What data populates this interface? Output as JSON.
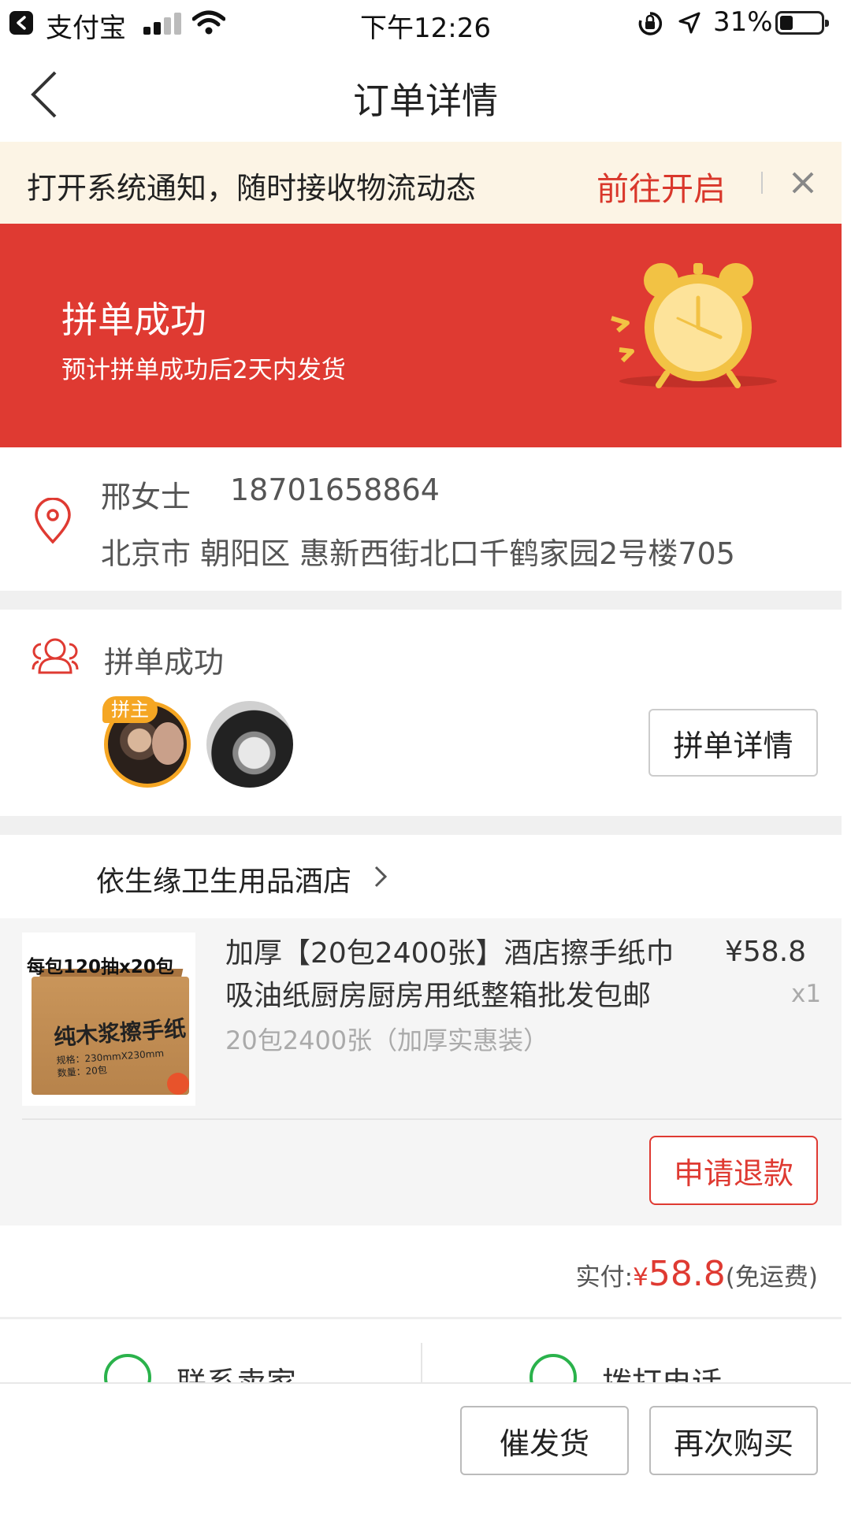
{
  "status_bar": {
    "app_name": "支付宝",
    "time": "下午12:26",
    "battery_pct": "31%",
    "battery_level": 0.31
  },
  "nav": {
    "title": "订单详情"
  },
  "notice": {
    "text": "打开系统通知，随时接收物流动态",
    "action": "前往开启"
  },
  "hero": {
    "title": "拼单成功",
    "subtitle": "预计拼单成功后2天内发货"
  },
  "address": {
    "name": "邢女士",
    "phone": "18701658864",
    "full": "北京市 朝阳区 惠新西街北口千鹤家园2号楼705"
  },
  "group": {
    "label": "拼单成功",
    "host_badge": "拼主",
    "detail_button": "拼单详情"
  },
  "shop": {
    "name": "依生缘卫生用品酒店"
  },
  "item": {
    "thumb_caption": "每包120抽x20包",
    "thumb_box_title": "纯木浆擦手纸",
    "thumb_spec_1": "规格：230mmX230mm",
    "thumb_spec_2": "数量：20包",
    "title": "加厚【20包2400张】酒店擦手纸巾吸油纸厨房厨房用纸整箱批发包邮",
    "price": "¥58.8",
    "qty": "x1",
    "spec": "20包2400张（加厚实惠装）",
    "refund_button": "申请退款"
  },
  "total": {
    "label": "实付:",
    "currency": "¥",
    "amount": "58.8",
    "note": "(免运费)"
  },
  "contact": {
    "seller": "联系卖家",
    "phone": "拨打电话"
  },
  "bottom": {
    "urge_button": "催发货",
    "rebuy_button": "再次购买"
  },
  "colors": {
    "accent_red": "#df3a32",
    "notice_bg": "#fcf4e5",
    "host_gold": "#f5a623",
    "contact_green": "#2ab24b"
  }
}
